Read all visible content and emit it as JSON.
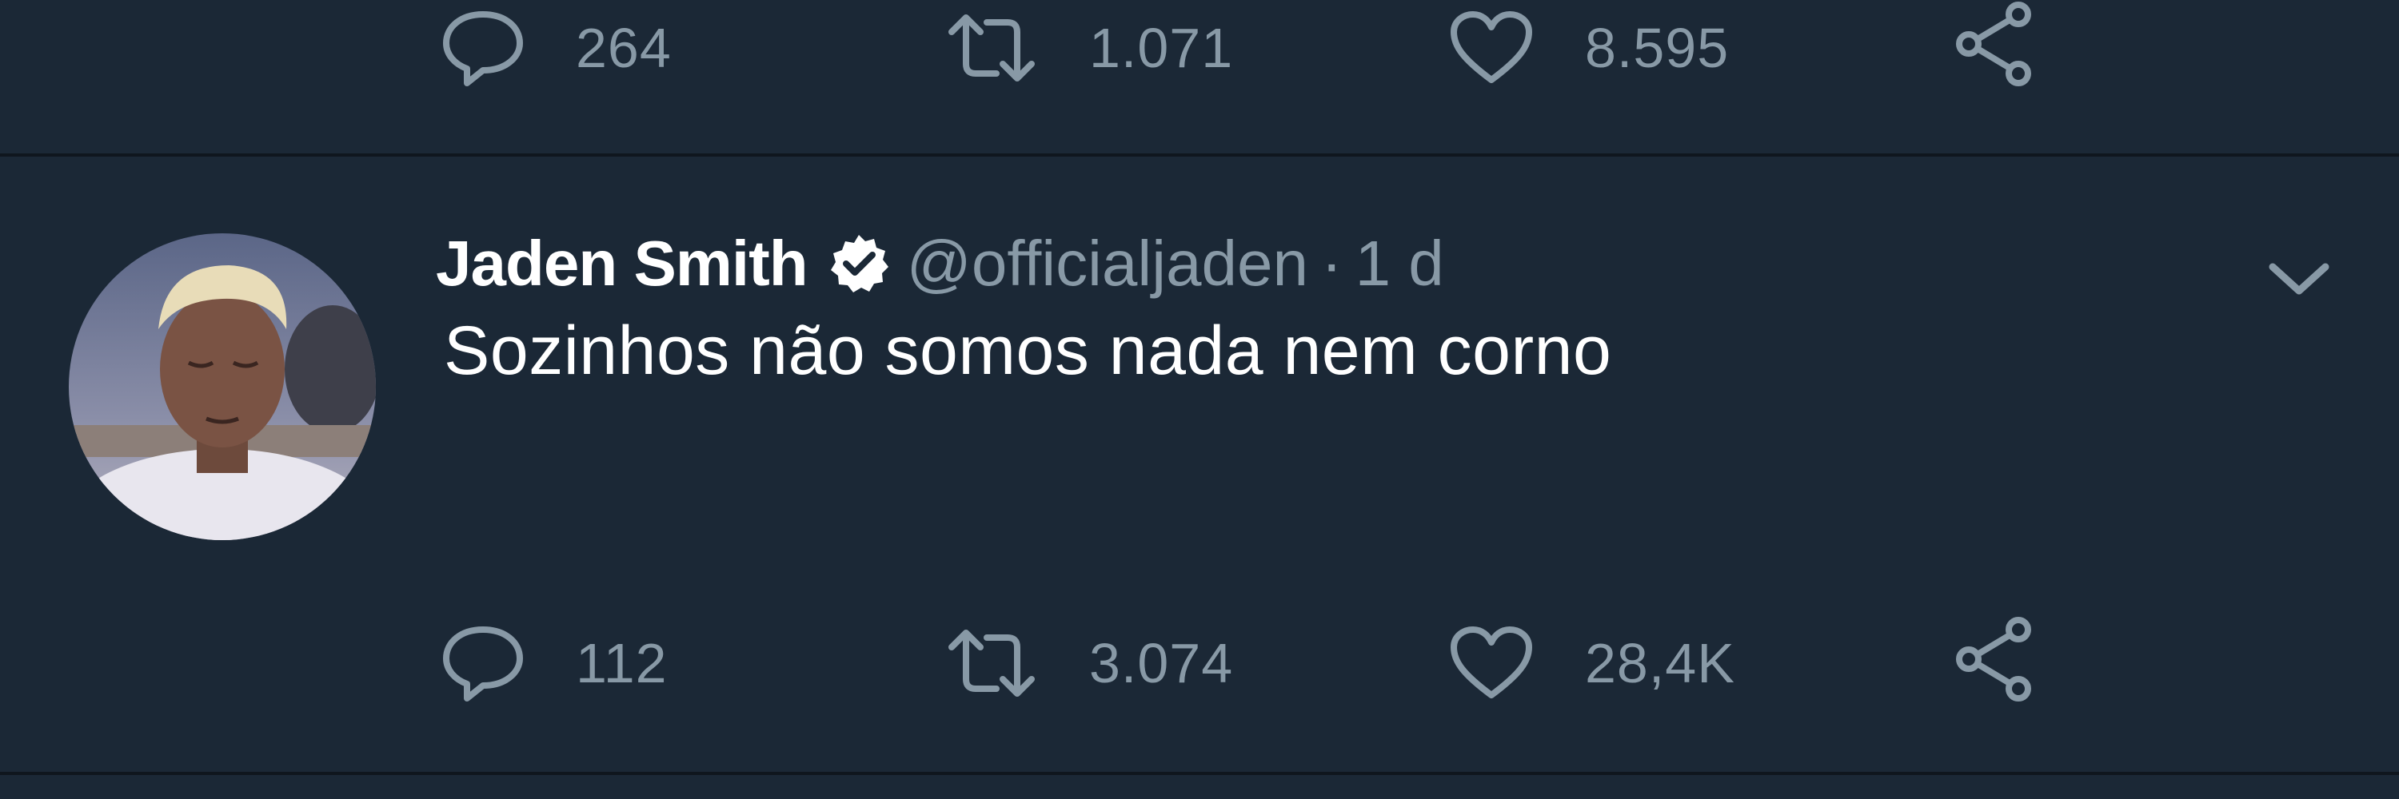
{
  "previous_tweet": {
    "actions": {
      "reply_count": "264",
      "retweet_count": "1.071",
      "like_count": "8.595"
    }
  },
  "tweet": {
    "author_name": "Jaden Smith",
    "verified": true,
    "handle": "@officialjaden",
    "separator": "·",
    "timestamp": "1 d",
    "text": "Sozinhos não somos nada nem corno",
    "actions": {
      "reply_count": "112",
      "retweet_count": "3.074",
      "like_count": "28,4K"
    }
  },
  "icons": {
    "reply": "speech-bubble-icon",
    "retweet": "retweet-arrows-icon",
    "like": "heart-outline-icon",
    "share": "share-nodes-icon",
    "verified": "verified-badge-icon",
    "menu": "chevron-down-icon"
  },
  "colors": {
    "background": "#1b2836",
    "divider": "#0f161e",
    "primary_text": "#ffffff",
    "secondary_text": "#8899a6"
  }
}
